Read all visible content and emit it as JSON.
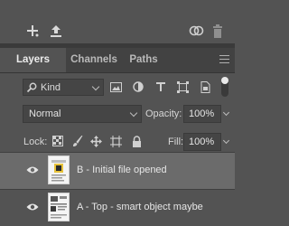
{
  "toolbar_icons": [
    "new-adjustment-plus-icon",
    "export-upload-icon",
    "link-rings-icon",
    "trash-icon"
  ],
  "tabs": [
    {
      "label": "Layers",
      "active": true
    },
    {
      "label": "Channels",
      "active": false
    },
    {
      "label": "Paths",
      "active": false
    }
  ],
  "filter": {
    "kind_label": "Kind",
    "icons": [
      "pixel-image-icon",
      "adjustment-circle-icon",
      "type-T-icon",
      "shape-transform-icon",
      "smart-object-icon"
    ]
  },
  "blend": {
    "mode": "Normal",
    "opacity_label": "Opacity:",
    "opacity_value": "100%"
  },
  "lock": {
    "label": "Lock:",
    "icons": [
      "lock-transparent-icon",
      "lock-brush-icon",
      "lock-move-icon",
      "lock-artboard-icon",
      "lock-all-icon"
    ],
    "fill_label": "Fill:",
    "fill_value": "100%"
  },
  "layers": [
    {
      "name": "B - Initial file opened",
      "visible": true,
      "selected": true
    },
    {
      "name": "A - Top - smart object maybe",
      "visible": true,
      "selected": false
    }
  ],
  "colors": {
    "panel": "#535353",
    "tabbar": "#424242",
    "selected_row": "#6b6b6b"
  }
}
